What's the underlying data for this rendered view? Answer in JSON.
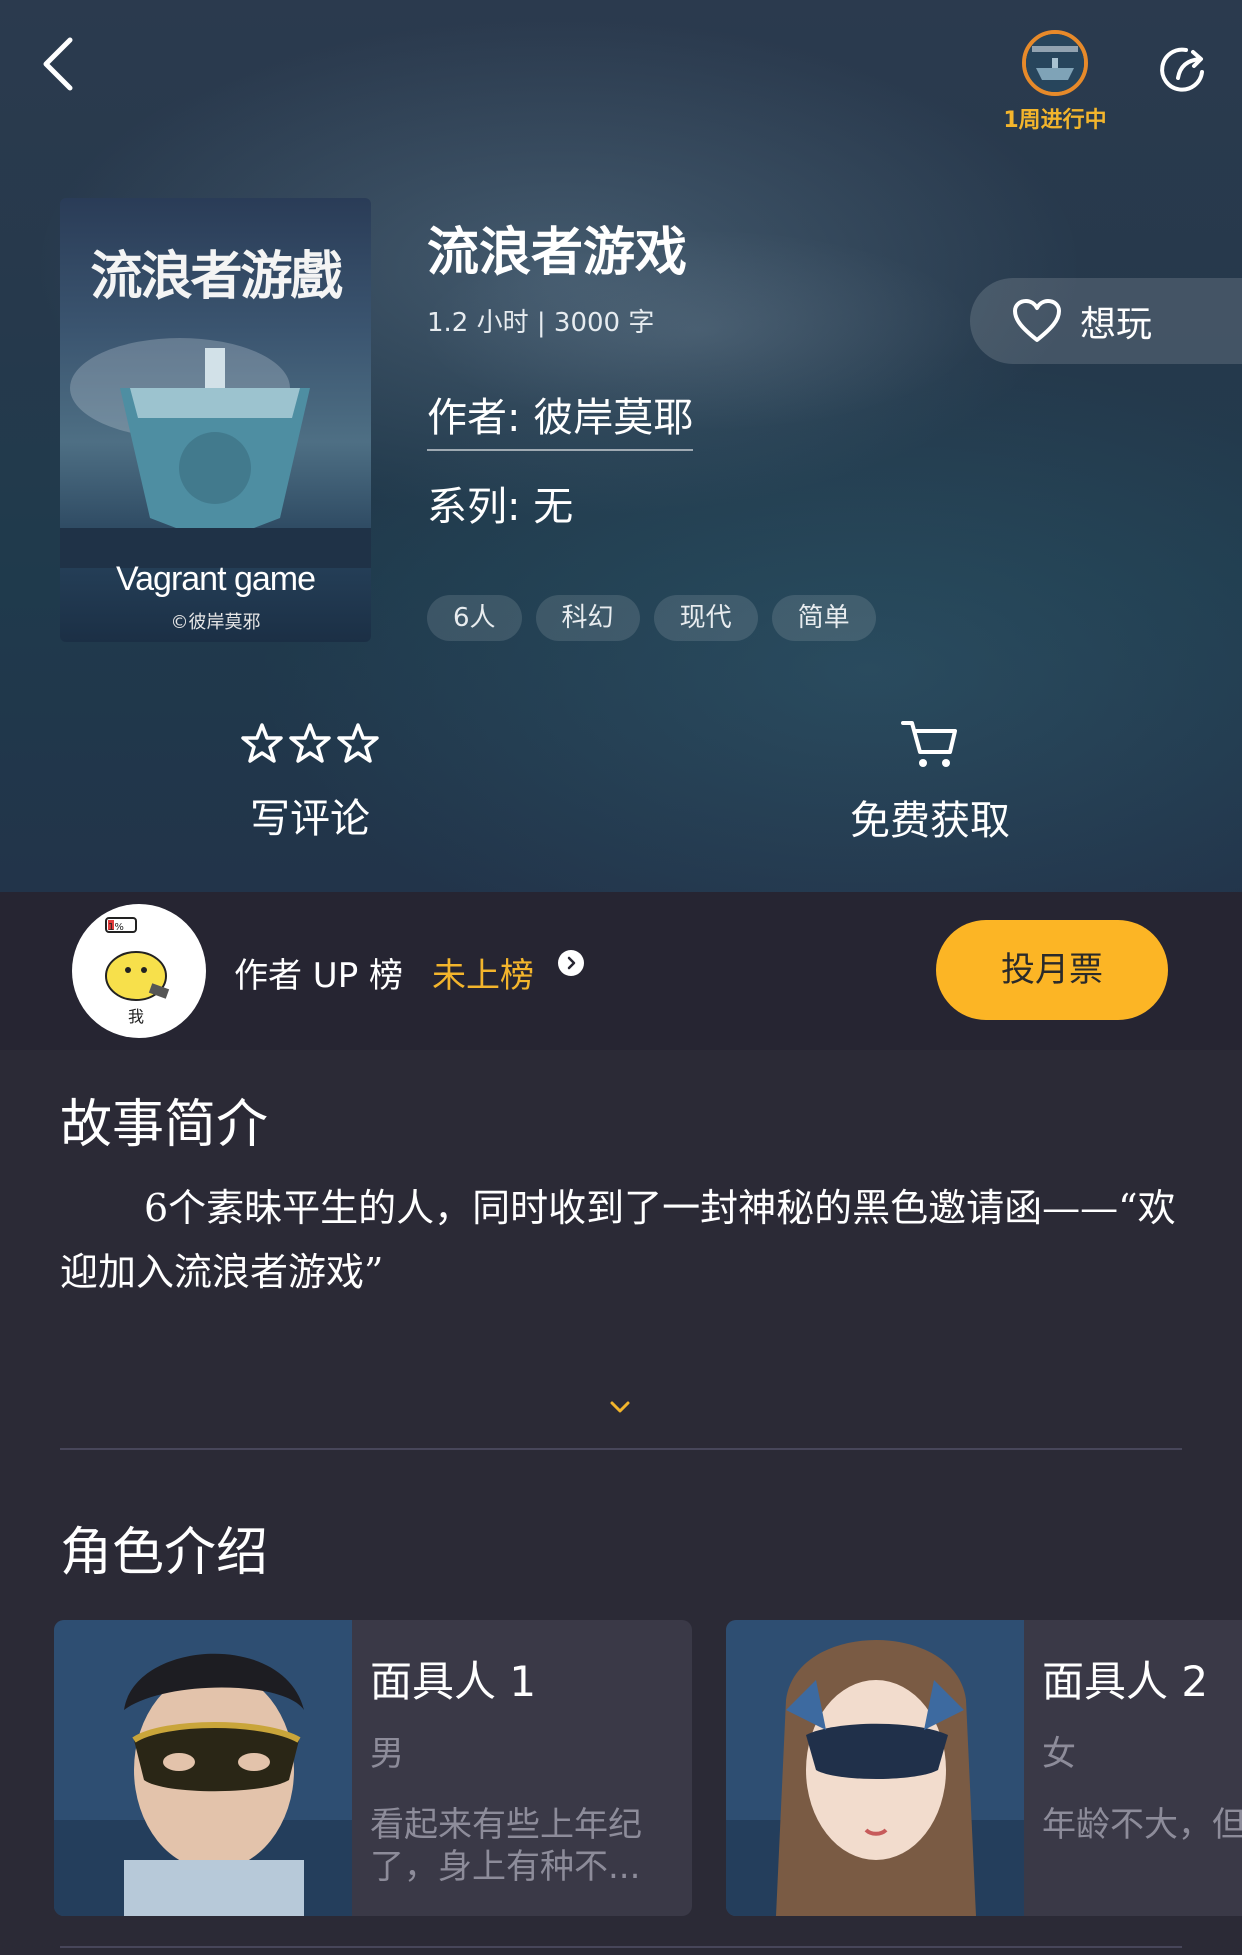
{
  "header": {
    "back_icon": "chevron-left-icon",
    "share_icon": "share-icon",
    "week_badge": "1周进行中"
  },
  "game": {
    "cover": {
      "title": "流浪者游戲",
      "subtitle_en": "Vagrant game",
      "copyright": "©彼岸莫邪"
    },
    "title": "流浪者游戏",
    "meta": "1.2 小时 | 3000 字",
    "author": "作者: 彼岸莫耶",
    "series": "系列: 无",
    "tags": [
      "6人",
      "科幻",
      "现代",
      "简单"
    ],
    "want_label": "想玩"
  },
  "actions": {
    "review_label": "写评论",
    "get_label": "免费获取"
  },
  "up_bar": {
    "avatar_battery": "1%",
    "avatar_text": "我",
    "label": "作者 UP 榜",
    "status": "未上榜",
    "vote_label": "投月票"
  },
  "story": {
    "heading": "故事简介",
    "text": "6个素昧平生的人，同时收到了一封神秘的黑色邀请函——“欢迎加入流浪者游戏”"
  },
  "characters": {
    "heading": "角色介绍",
    "items": [
      {
        "name": "面具人 1",
        "gender": "男",
        "desc": "看起来有些上年纪了，身上有种不..."
      },
      {
        "name": "面具人 2",
        "gender": "女",
        "desc": "年龄不大，但似乎能洞察人"
      }
    ]
  },
  "colors": {
    "accent": "#fcb525",
    "badge_text": "#f3b52c",
    "background": "#2b2a36"
  }
}
